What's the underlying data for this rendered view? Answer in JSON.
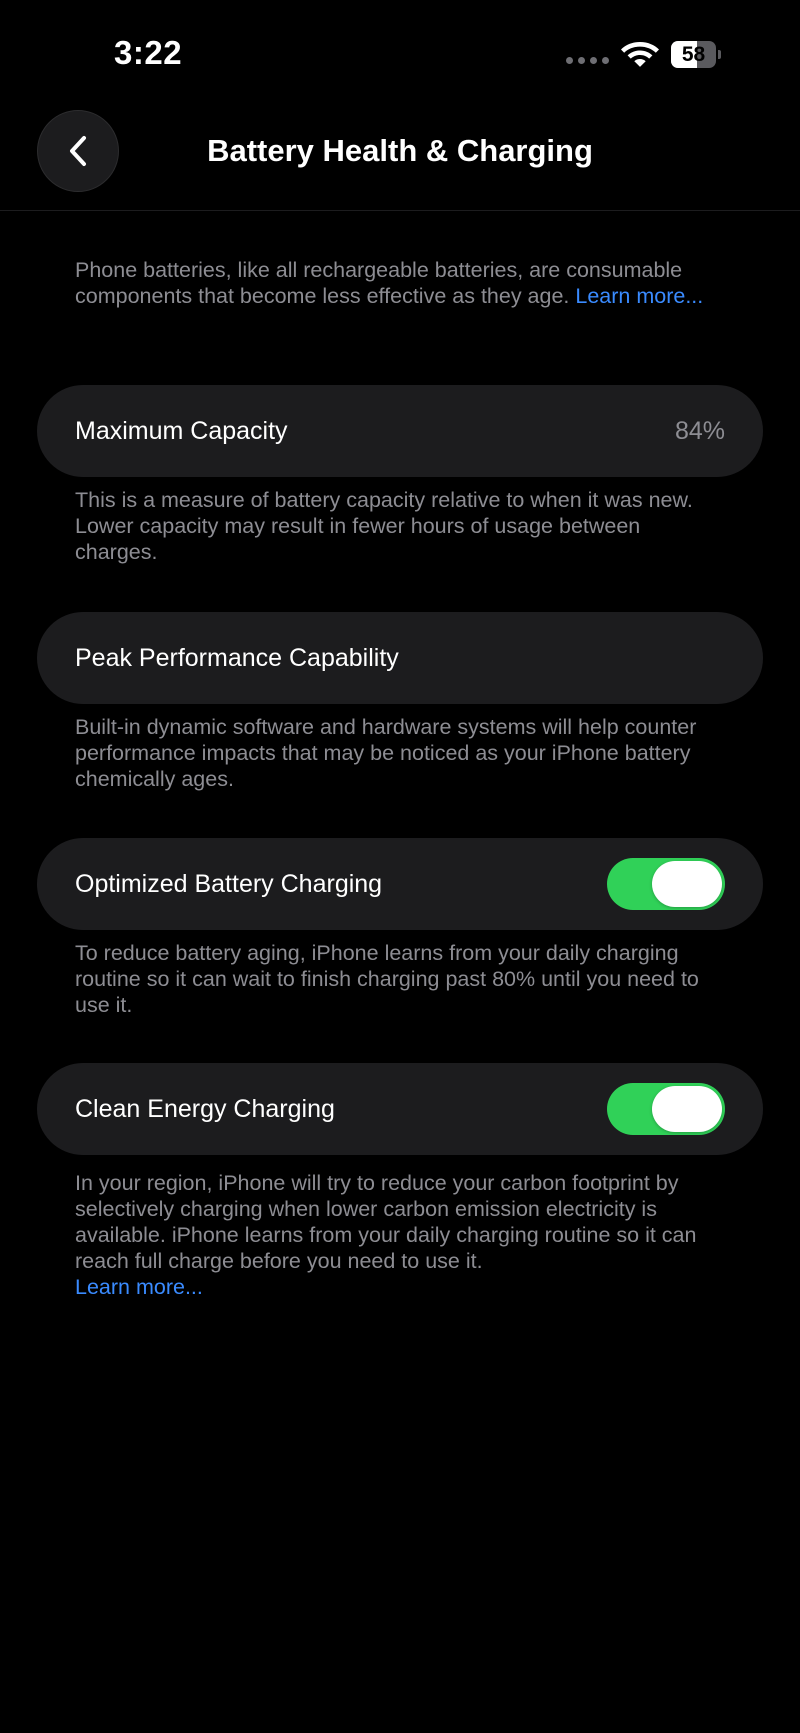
{
  "status_bar": {
    "time": "3:22",
    "battery_level": "58",
    "battery_fraction": 0.58,
    "wifi_icon": "wifi-icon",
    "signal_icon": "signal-dots-icon"
  },
  "nav": {
    "title": "Battery Health & Charging",
    "back_icon": "chevron-left-icon"
  },
  "intro": {
    "text": "Phone batteries, like all rechargeable batteries, are consumable components that become less effective as they age.",
    "link": "Learn more..."
  },
  "maximum_capacity": {
    "label": "Maximum Capacity",
    "value": "84%",
    "footnote": "This is a measure of battery capacity relative to when it was new. Lower capacity may result in fewer hours of usage between charges."
  },
  "peak_performance": {
    "label": "Peak Performance Capability",
    "footnote": "Built-in dynamic software and hardware systems will help counter performance impacts that may be noticed as your iPhone battery chemically ages."
  },
  "optimized_charging": {
    "label": "Optimized Battery Charging",
    "enabled": true,
    "footnote": "To reduce battery aging, iPhone learns from your daily charging routine so it can wait to finish charging past 80% until you need to use it."
  },
  "clean_energy": {
    "label": "Clean Energy Charging",
    "enabled": true,
    "footnote": "In your region, iPhone will try to reduce your carbon footprint by selectively charging when lower carbon emission electricity is available. iPhone learns from your daily charging routine so it can reach full charge before you need to use it.",
    "link": "Learn more..."
  },
  "colors": {
    "background": "#000000",
    "cell_background": "#1c1c1e",
    "secondary_text": "#8d8d93",
    "link": "#3a8bff",
    "toggle_on": "#30d158"
  }
}
